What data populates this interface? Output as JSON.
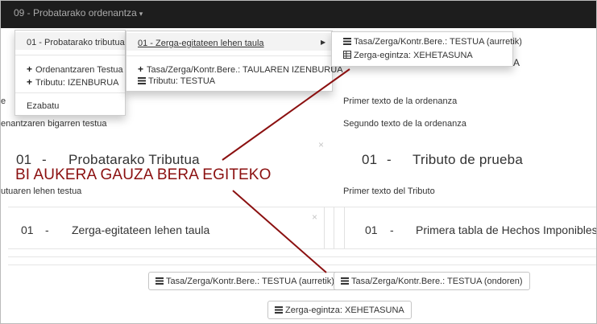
{
  "topbar": {
    "title": "09 - Probatarako ordenantza",
    "caret": "▾"
  },
  "menu1": {
    "item_tributua": "01 - Probatarako tributua",
    "item_ordenantza_testua": "Ordenantzaren Testua",
    "item_tributu_izenburua": "Tributu: IZENBURUA",
    "item_ezabatu": "Ezabatu"
  },
  "menu2": {
    "item_taula": "01 - Zerga-egitateen lehen taula",
    "item_taularen_izenburua": "Tasa/Zerga/Kontr.Bere.: TAULAREN IZENBURUA",
    "item_tributu_testua": "Tributu: TESTUA"
  },
  "menu3": {
    "item_testua_aurretik": "Tasa/Zerga/Kontr.Bere.: TESTUA (aurretik)",
    "item_xehetasuna": "Zerga-egintza: XEHETASUNA"
  },
  "content": {
    "left_partial_1": "e",
    "left_partial_2": "enantzaren bigarren testua",
    "right_text_1": "Primer texto de la ordenanza",
    "right_text_2": "Segundo texto de la ordenanza",
    "right_partial_a": "A",
    "tributua_num_left": "01",
    "dash": "-",
    "tributua_title_left": "Probatarako Tributua",
    "tributua_num_right": "01",
    "tributua_title_right": "Tributo de prueba",
    "left_partial_3": "utuaren lehen testua",
    "right_text_3": "Primer texto del Tributo",
    "taula_num_left": "01",
    "taula_title_left": "Zerga-egitateen lehen taula",
    "taula_num_right": "01",
    "taula_title_right": "Primera tabla de Hechos Imponibles",
    "close_symbol": "×"
  },
  "buttons": {
    "testua_aurretik": "Tasa/Zerga/Kontr.Bere.: TESTUA (aurretik)",
    "testua_ondoren": "Tasa/Zerga/Kontr.Bere.: TESTUA (ondoren)",
    "xehetasuna": "Zerga-egintza: XEHETASUNA"
  },
  "annotation": {
    "text": "BI AUKERA GAUZA BERA EGITEKO",
    "color": "#8b1010"
  }
}
